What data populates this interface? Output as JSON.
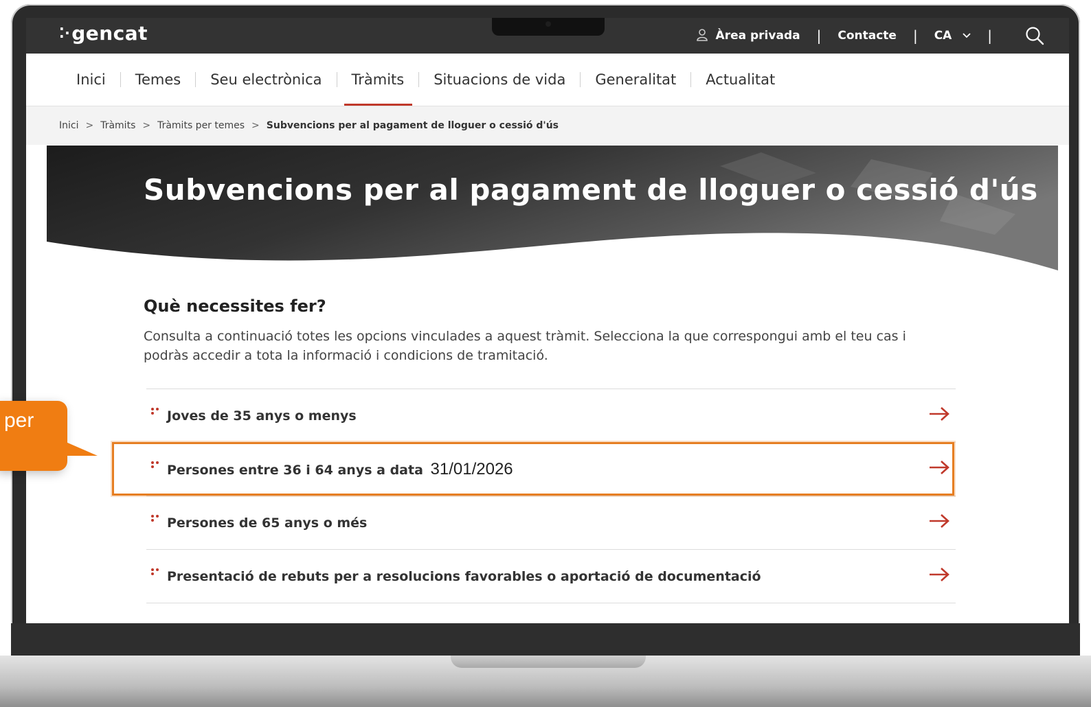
{
  "topbar": {
    "logo": "gencat",
    "area_privada": "Àrea privada",
    "contacte": "Contacte",
    "language": "CA"
  },
  "nav": {
    "items": [
      {
        "label": "Inici"
      },
      {
        "label": "Temes"
      },
      {
        "label": "Seu electrònica"
      },
      {
        "label": "Tràmits"
      },
      {
        "label": "Situacions de vida"
      },
      {
        "label": "Generalitat"
      },
      {
        "label": "Actualitat"
      }
    ],
    "active": "Tràmits"
  },
  "breadcrumb": {
    "items": [
      "Inici",
      "Tràmits",
      "Tràmits per temes"
    ],
    "current": "Subvencions per al pagament de lloguer o cessió d'ús"
  },
  "hero": {
    "title": "Subvencions per al pagament de lloguer o cessió d'ús"
  },
  "main": {
    "section_title": "Què necessites fer?",
    "intro": "Consulta a continuació totes les opcions vinculades a aquest tràmit. Selecciona la que correspongui amb el teu cas i podràs accedir a tota la informació i condicions de tramitació.",
    "options": [
      {
        "label": "Joves de 35 anys o menys"
      },
      {
        "label": "Persones entre 36 i 64 anys a data",
        "date": "31/01/2026"
      },
      {
        "label": "Persones de 65 anys o més"
      },
      {
        "label": "Presentació de rebuts per a resolucions favorables o aportació de documentació"
      }
    ]
  },
  "callout": {
    "text": "per"
  },
  "colors": {
    "topbar": "#333333",
    "accent_red": "#c0392b",
    "highlight_orange": "#e67e22",
    "callout_orange": "#f07d12"
  }
}
